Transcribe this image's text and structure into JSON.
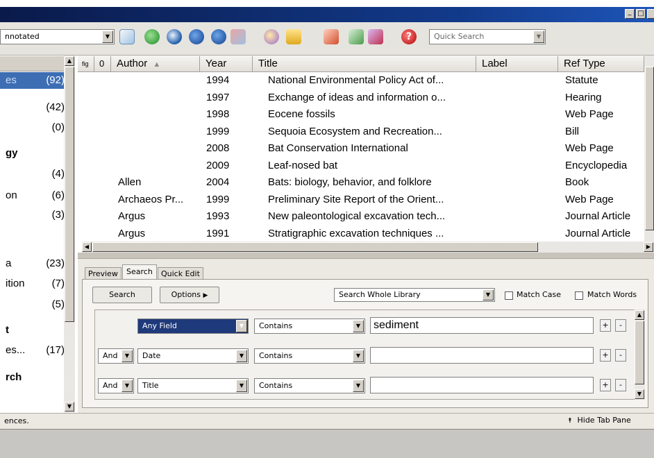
{
  "toolbar": {
    "filter_value": "nnotated",
    "quick_search_placeholder": "Quick Search"
  },
  "sidebar": {
    "items": [
      {
        "name": "es",
        "count": "(92)"
      },
      {
        "name": "",
        "count": "(42)"
      },
      {
        "name": "",
        "count": "(0)"
      },
      {
        "name": "gy",
        "count": ""
      },
      {
        "name": "",
        "count": "(4)"
      },
      {
        "name": "on",
        "count": "(6)"
      },
      {
        "name": "",
        "count": "(3)"
      },
      {
        "name": "a",
        "count": "(23)"
      },
      {
        "name": "ition",
        "count": "(7)"
      },
      {
        "name": "",
        "count": "(5)"
      },
      {
        "name": "t",
        "count": ""
      },
      {
        "name": "es...",
        "count": "(17)"
      },
      {
        "name": "rch",
        "count": ""
      }
    ]
  },
  "table": {
    "headers": {
      "fig": "fig",
      "attach": "0",
      "author": "Author",
      "year": "Year",
      "title": "Title",
      "label": "Label",
      "reftype": "Ref Type"
    },
    "rows": [
      {
        "author": "",
        "year": "1994",
        "title": "National Environmental Policy Act of...",
        "label": "",
        "reftype": "Statute"
      },
      {
        "author": "",
        "year": "1997",
        "title": "Exchange of ideas and information o...",
        "label": "",
        "reftype": "Hearing"
      },
      {
        "author": "",
        "year": "1998",
        "title": "Eocene fossils",
        "label": "",
        "reftype": "Web Page"
      },
      {
        "author": "",
        "year": "1999",
        "title": "Sequoia Ecosystem and Recreation...",
        "label": "",
        "reftype": "Bill"
      },
      {
        "author": "",
        "year": "2008",
        "title": "Bat Conservation International",
        "label": "",
        "reftype": "Web Page"
      },
      {
        "author": "",
        "year": "2009",
        "title": "Leaf-nosed bat",
        "label": "",
        "reftype": "Encyclopedia"
      },
      {
        "author": "Allen",
        "year": "2004",
        "title": "Bats: biology, behavior, and folklore",
        "label": "",
        "reftype": "Book"
      },
      {
        "author": "Archaeos Pr...",
        "year": "1999",
        "title": "Preliminary Site Report of the Orient...",
        "label": "",
        "reftype": "Web Page"
      },
      {
        "author": "Argus",
        "year": "1993",
        "title": "New paleontological excavation tech...",
        "label": "",
        "reftype": "Journal Article"
      },
      {
        "author": "Argus",
        "year": "1991",
        "title": "Stratigraphic excavation techniques ...",
        "label": "",
        "reftype": "Journal Article"
      }
    ]
  },
  "tabs": {
    "preview": "Preview",
    "search": "Search",
    "quick_edit": "Quick Edit"
  },
  "search": {
    "search_button": "Search",
    "options_button": "Options",
    "scope": "Search Whole Library",
    "match_case": "Match Case",
    "match_words": "Match Words",
    "rows": [
      {
        "bool": "",
        "field": "Any Field",
        "op": "Contains",
        "value": "sediment"
      },
      {
        "bool": "And",
        "field": "Date",
        "op": "Contains",
        "value": ""
      },
      {
        "bool": "And",
        "field": "Title",
        "op": "Contains",
        "value": ""
      }
    ],
    "plus": "+",
    "minus": "-"
  },
  "status": {
    "left": "ences.",
    "hide_tab_pane": "Hide Tab Pane"
  },
  "window": {
    "min": "_",
    "max": "□"
  }
}
